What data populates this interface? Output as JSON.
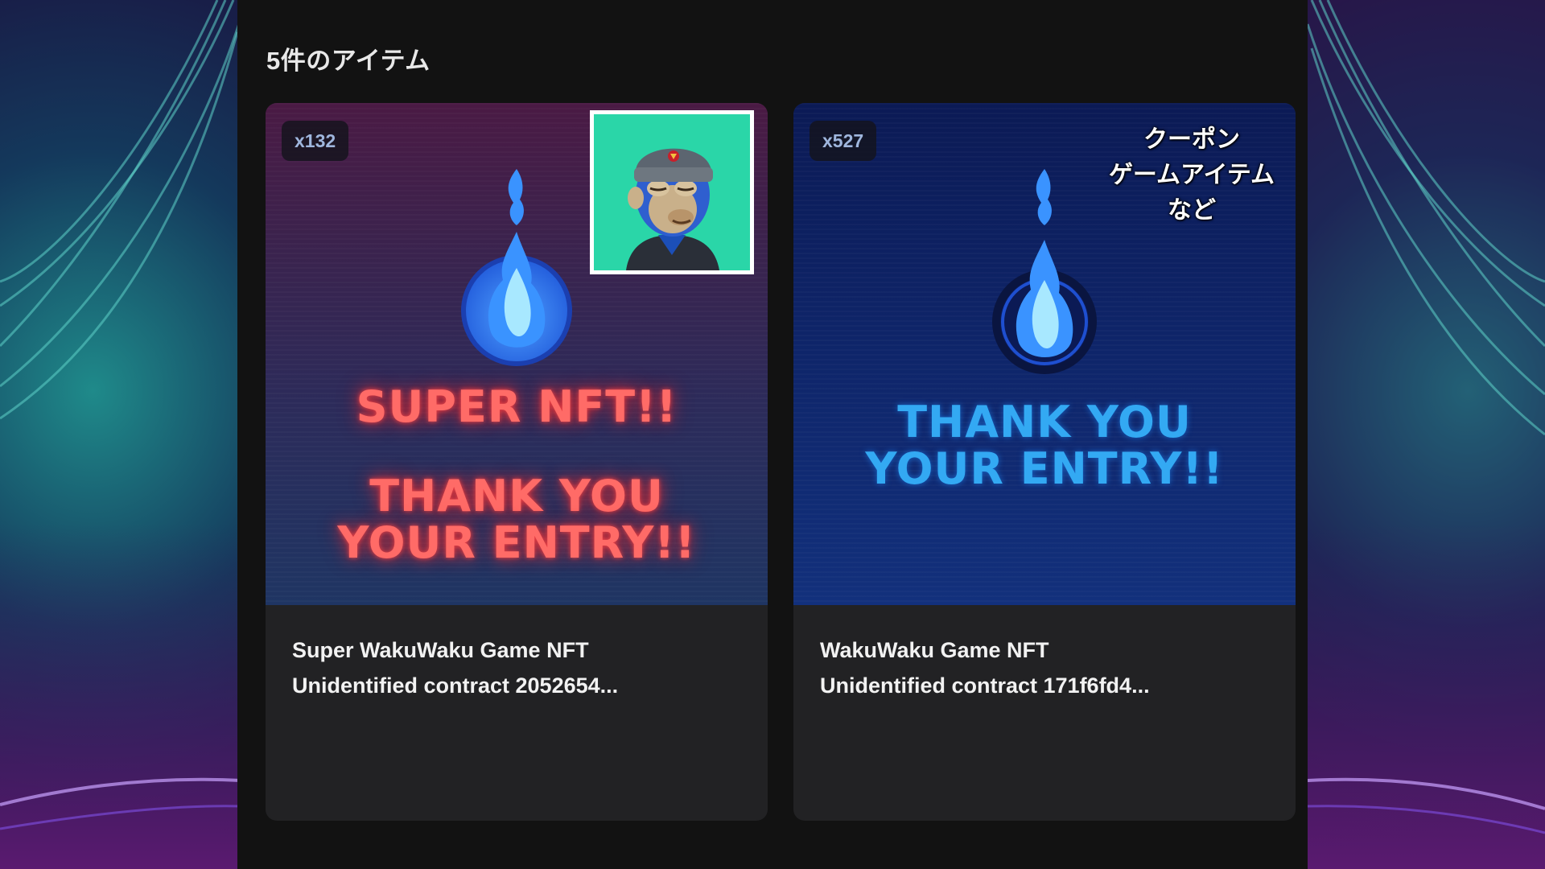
{
  "page": {
    "title": "5件のアイテム"
  },
  "items": [
    {
      "quantity": "x132",
      "art_lines_top": [
        "SUPER NFT!!"
      ],
      "art_lines_bottom": [
        "THANK YOU",
        "YOUR ENTRY!!"
      ],
      "name": "Super WakuWaku Game NFT",
      "contract": "Unidentified contract 2052654..."
    },
    {
      "quantity": "x527",
      "art_lines_bottom": [
        "THANK YOU",
        "YOUR ENTRY!!"
      ],
      "overlay_lines": [
        "クーポン",
        "ゲームアイテム",
        "など"
      ],
      "name": "WakuWaku Game NFT",
      "contract": "Unidentified contract 171f6fd4..."
    }
  ],
  "colors": {
    "panel_bg": "#121212",
    "card_bg": "#222224",
    "neon_red": "#ff6b67",
    "neon_blue": "#33a9f3",
    "badge_text": "#9fb6dd"
  }
}
